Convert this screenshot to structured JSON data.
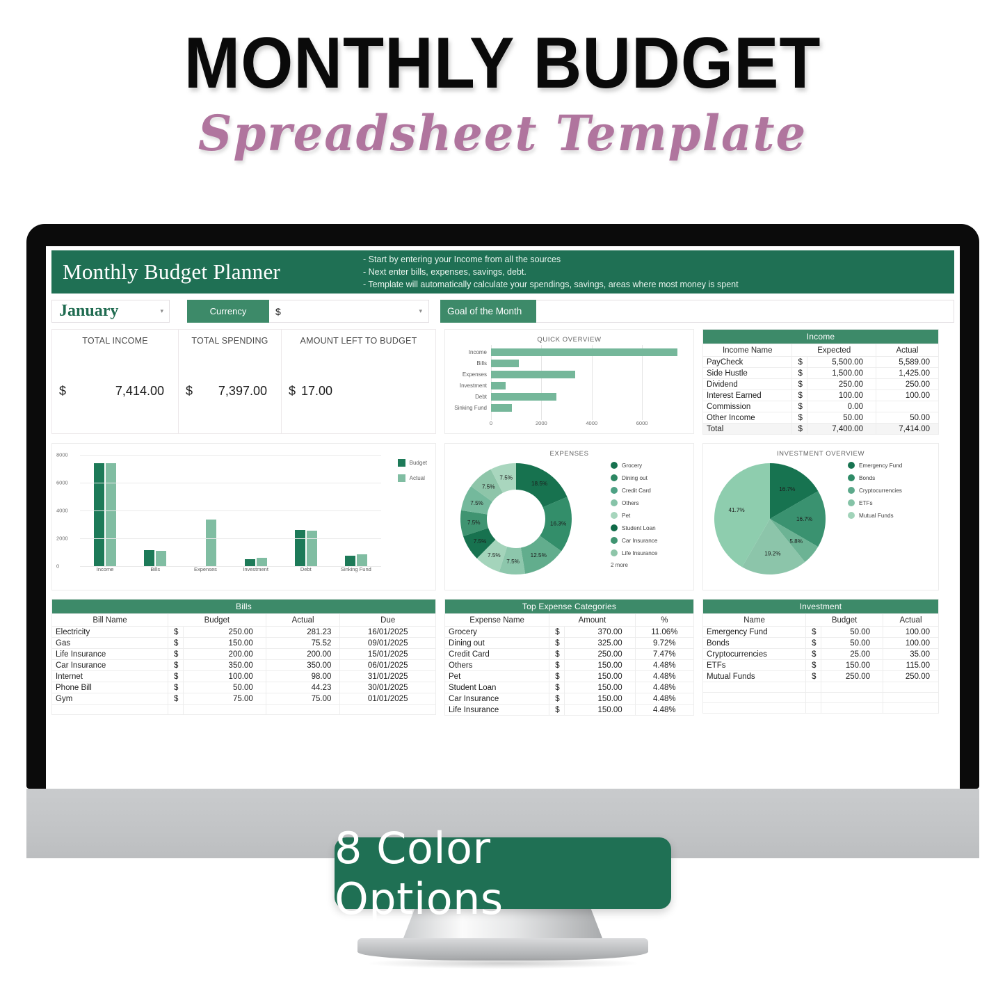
{
  "poster": {
    "title": "MONTHLY BUDGET",
    "subtitle": "Spreadsheet Template",
    "badge": "8 Color Options",
    "accent_green": "#1f7054",
    "accent_pink": "#b0759e"
  },
  "sheet": {
    "header_title": "Monthly Budget Planner",
    "instructions": [
      "- Start by entering your Income from all the sources",
      "- Next enter bills, expenses, savings, debt.",
      "- Template will automatically calculate your spendings, savings, areas where most money is spent"
    ],
    "controls": {
      "month": "January",
      "currency_label": "Currency",
      "currency_value": "$",
      "goal_label": "Goal of the Month",
      "goal_value": ""
    },
    "summary": [
      {
        "label": "TOTAL INCOME",
        "currency": "$",
        "value": "7,414.00"
      },
      {
        "label": "TOTAL SPENDING",
        "currency": "$",
        "value": "7,397.00"
      },
      {
        "label": "AMOUNT LEFT TO BUDGET",
        "currency": "$",
        "value": "17.00"
      }
    ],
    "income_table": {
      "title": "Income",
      "columns": [
        "Income Name",
        "Expected",
        "Actual"
      ],
      "rows": [
        {
          "name": "PayCheck",
          "cur": "$",
          "expected": "5,500.00",
          "actual": "5,589.00"
        },
        {
          "name": "Side Hustle",
          "cur": "$",
          "expected": "1,500.00",
          "actual": "1,425.00"
        },
        {
          "name": "Dividend",
          "cur": "$",
          "expected": "250.00",
          "actual": "250.00"
        },
        {
          "name": "Interest Earned",
          "cur": "$",
          "expected": "100.00",
          "actual": "100.00"
        },
        {
          "name": "Commission",
          "cur": "$",
          "expected": "0.00",
          "actual": ""
        },
        {
          "name": "Other Income",
          "cur": "$",
          "expected": "50.00",
          "actual": "50.00"
        },
        {
          "name": "Total",
          "cur": "$",
          "expected": "7,400.00",
          "actual": "7,414.00"
        }
      ]
    },
    "bills_table": {
      "title": "Bills",
      "columns": [
        "Bill Name",
        "Budget",
        "Actual",
        "Due"
      ],
      "rows": [
        {
          "name": "Electricity",
          "cur": "$",
          "budget": "250.00",
          "actual": "281.23",
          "due": "16/01/2025"
        },
        {
          "name": "Gas",
          "cur": "$",
          "budget": "150.00",
          "actual": "75.52",
          "due": "09/01/2025"
        },
        {
          "name": "Life Insurance",
          "cur": "$",
          "budget": "200.00",
          "actual": "200.00",
          "due": "15/01/2025"
        },
        {
          "name": "Car Insurance",
          "cur": "$",
          "budget": "350.00",
          "actual": "350.00",
          "due": "06/01/2025"
        },
        {
          "name": "Internet",
          "cur": "$",
          "budget": "100.00",
          "actual": "98.00",
          "due": "31/01/2025"
        },
        {
          "name": "Phone Bill",
          "cur": "$",
          "budget": "50.00",
          "actual": "44.23",
          "due": "30/01/2025"
        },
        {
          "name": "Gym",
          "cur": "$",
          "budget": "75.00",
          "actual": "75.00",
          "due": "01/01/2025"
        }
      ]
    },
    "expense_table": {
      "title": "Top Expense Categories",
      "columns": [
        "Expense Name",
        "Amount",
        "%"
      ],
      "rows": [
        {
          "name": "Grocery",
          "cur": "$",
          "amount": "370.00",
          "pct": "11.06%"
        },
        {
          "name": "Dining out",
          "cur": "$",
          "amount": "325.00",
          "pct": "9.72%"
        },
        {
          "name": "Credit Card",
          "cur": "$",
          "amount": "250.00",
          "pct": "7.47%"
        },
        {
          "name": "Others",
          "cur": "$",
          "amount": "150.00",
          "pct": "4.48%"
        },
        {
          "name": "Pet",
          "cur": "$",
          "amount": "150.00",
          "pct": "4.48%"
        },
        {
          "name": "Student Loan",
          "cur": "$",
          "amount": "150.00",
          "pct": "4.48%"
        },
        {
          "name": "Car Insurance",
          "cur": "$",
          "amount": "150.00",
          "pct": "4.48%"
        },
        {
          "name": "Life Insurance",
          "cur": "$",
          "amount": "150.00",
          "pct": "4.48%"
        }
      ]
    },
    "investment_table": {
      "title": "Investment",
      "columns": [
        "Name",
        "Budget",
        "Actual"
      ],
      "rows": [
        {
          "name": "Emergency Fund",
          "cur": "$",
          "budget": "50.00",
          "actual": "100.00"
        },
        {
          "name": "Bonds",
          "cur": "$",
          "budget": "50.00",
          "actual": "100.00"
        },
        {
          "name": "Cryptocurrencies",
          "cur": "$",
          "budget": "25.00",
          "actual": "35.00"
        },
        {
          "name": "ETFs",
          "cur": "$",
          "budget": "150.00",
          "actual": "115.00"
        },
        {
          "name": "Mutual Funds",
          "cur": "$",
          "budget": "250.00",
          "actual": "250.00"
        }
      ]
    }
  },
  "chart_data": [
    {
      "type": "bar",
      "id": "quick-overview",
      "orientation": "horizontal",
      "title": "QUICK OVERVIEW",
      "categories": [
        "Income",
        "Bills",
        "Expenses",
        "Investment",
        "Debt",
        "Sinking Fund"
      ],
      "values": [
        7414,
        1095,
        3345,
        590,
        2600,
        825
      ],
      "xlabel": "",
      "ylabel": "",
      "xlim": [
        0,
        7600
      ],
      "ticks": [
        0,
        2000,
        4000,
        6000
      ],
      "grid": true,
      "color": "#75b79a",
      "legend": "none"
    },
    {
      "type": "bar",
      "id": "budget-vs-actual",
      "orientation": "vertical",
      "title": "",
      "categories": [
        "Income",
        "Bills",
        "Expenses",
        "Investment",
        "Debt",
        "Sinking Fund"
      ],
      "series": [
        {
          "name": "Budget",
          "color": "#1d7a58",
          "values": [
            7400,
            1175,
            0,
            525,
            2625,
            775
          ]
        },
        {
          "name": "Actual",
          "color": "#80bda2",
          "values": [
            7414,
            1124,
            3345,
            600,
            2550,
            850
          ]
        }
      ],
      "ylim": [
        0,
        8000
      ],
      "yticks": [
        0,
        2000,
        4000,
        6000,
        8000
      ],
      "grid": true,
      "legend": "right"
    },
    {
      "type": "pie",
      "id": "expenses-donut",
      "title": "EXPENSES",
      "donut": true,
      "labels": [
        "Grocery",
        "Dining out",
        "Credit Card",
        "Others",
        "Pet",
        "Student Loan",
        "Car Insurance",
        "Life Insurance"
      ],
      "values": [
        18.5,
        16.3,
        12.5,
        7.5,
        7.5,
        7.5,
        7.5,
        7.5
      ],
      "slice_labels": [
        "18.5%",
        "16.3%",
        "12.5%",
        "7.5%",
        "7.5%",
        "7.5%",
        "7.5%",
        "7.5%",
        "7.5%",
        "7.5%"
      ],
      "slice_values": [
        18.5,
        16.3,
        12.5,
        7.5,
        7.5,
        7.5,
        7.5,
        7.5,
        7.5,
        7.5
      ],
      "slice_colors": [
        "#17724f",
        "#338e6a",
        "#62ad8d",
        "#8dc7ac",
        "#a4d4bb",
        "#17724f",
        "#3f9471",
        "#74b99c",
        "#8ec5a9",
        "#a9d6be"
      ],
      "legend_colors": [
        "#17724f",
        "#2d8763",
        "#4da184",
        "#86c3a8",
        "#a6d5bc",
        "#0f6a48",
        "#3f9471",
        "#8ec5a9"
      ],
      "legend_position": "right",
      "legend_more": "2 more"
    },
    {
      "type": "pie",
      "id": "investment-overview",
      "title": "INVESTMENT OVERVIEW",
      "donut": false,
      "labels": [
        "Emergency Fund",
        "Bonds",
        "Cryptocurrencies",
        "ETFs",
        "Mutual Funds"
      ],
      "values": [
        16.7,
        16.7,
        5.8,
        19.2,
        41.7
      ],
      "slice_labels": [
        "16.7%",
        "16.7%",
        "5.8%",
        "19.2%",
        "41.7%"
      ],
      "colors": [
        "#177350",
        "#3a9270",
        "#6cb394",
        "#8cc5aa",
        "#8ecdae"
      ],
      "legend_colors": [
        "#177350",
        "#2f8b67",
        "#5ca98b",
        "#85c3a7",
        "#a1d3b9"
      ],
      "legend_position": "right"
    }
  ]
}
